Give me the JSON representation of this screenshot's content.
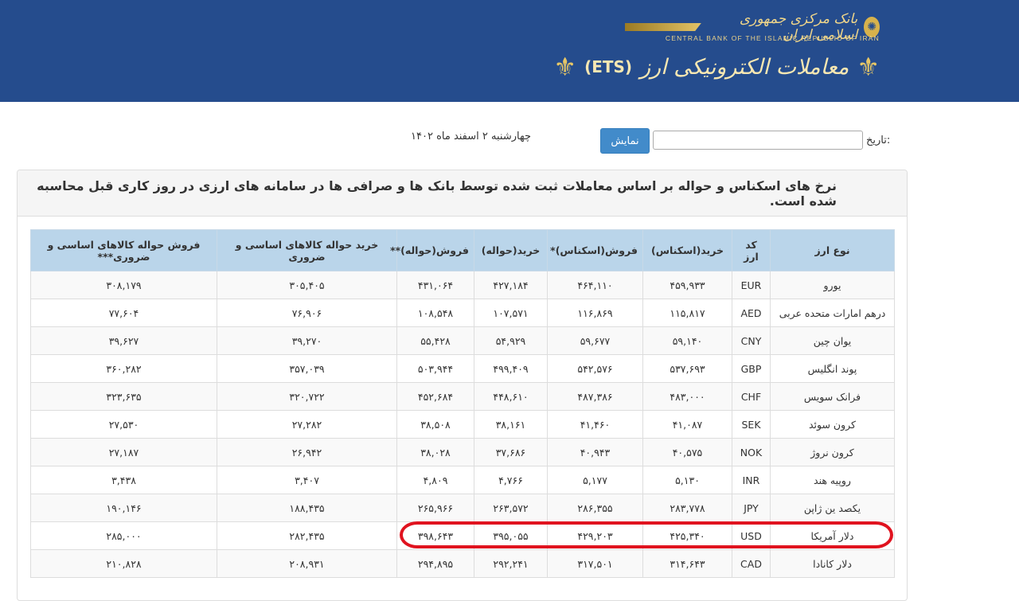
{
  "header": {
    "bank_name_fa": "بانک مرکزی جمهوری اسلامی ایران",
    "bank_name_en": "CENTRAL BANK OF THE ISLAMIC REPUBLIC OF IRAN",
    "system_name_fa": "معاملات الکترونیکی ارز",
    "system_name_en": "(ETS)"
  },
  "filter": {
    "date_label": "تاریخ:",
    "date_value": "",
    "show_button": "نمایش",
    "current_date": "چهارشنبه ۲ اسفند ماه ۱۴۰۲"
  },
  "panel": {
    "title": "نرخ های اسکناس و حواله بر اساس معاملات ثبت شده توسط بانک ها و صرافی ها در سامانه های ارزی در روز کاری قبل محاسبه شده است."
  },
  "table": {
    "columns": [
      "نوع ارز",
      "کد ارز",
      "خرید(اسکناس)",
      "فروش(اسکناس)*",
      "خرید(حواله)",
      "فروش(حواله)**",
      "خرید حواله کالاهای اساسی و ضروری",
      "فروش حواله کالاهای اساسی و ضروری***"
    ],
    "rows": [
      [
        "یورو",
        "EUR",
        "۴۵۹,۹۳۳",
        "۴۶۴,۱۱۰",
        "۴۲۷,۱۸۴",
        "۴۳۱,۰۶۴",
        "۳۰۵,۴۰۵",
        "۳۰۸,۱۷۹"
      ],
      [
        "درهم امارات متحده عربی",
        "AED",
        "۱۱۵,۸۱۷",
        "۱۱۶,۸۶۹",
        "۱۰۷,۵۷۱",
        "۱۰۸,۵۴۸",
        "۷۶,۹۰۶",
        "۷۷,۶۰۴"
      ],
      [
        "یوان چین",
        "CNY",
        "۵۹,۱۴۰",
        "۵۹,۶۷۷",
        "۵۴,۹۲۹",
        "۵۵,۴۲۸",
        "۳۹,۲۷۰",
        "۳۹,۶۲۷"
      ],
      [
        "پوند انگلیس",
        "GBP",
        "۵۳۷,۶۹۳",
        "۵۴۲,۵۷۶",
        "۴۹۹,۴۰۹",
        "۵۰۳,۹۴۴",
        "۳۵۷,۰۳۹",
        "۳۶۰,۲۸۲"
      ],
      [
        "فرانک سویس",
        "CHF",
        "۴۸۳,۰۰۰",
        "۴۸۷,۳۸۶",
        "۴۴۸,۶۱۰",
        "۴۵۲,۶۸۴",
        "۳۲۰,۷۲۲",
        "۳۲۳,۶۳۵"
      ],
      [
        "کرون سوئد",
        "SEK",
        "۴۱,۰۸۷",
        "۴۱,۴۶۰",
        "۳۸,۱۶۱",
        "۳۸,۵۰۸",
        "۲۷,۲۸۲",
        "۲۷,۵۳۰"
      ],
      [
        "کرون نروژ",
        "NOK",
        "۴۰,۵۷۵",
        "۴۰,۹۴۳",
        "۳۷,۶۸۶",
        "۳۸,۰۲۸",
        "۲۶,۹۴۲",
        "۲۷,۱۸۷"
      ],
      [
        "روپیه هند",
        "INR",
        "۵,۱۳۰",
        "۵,۱۷۷",
        "۴,۷۶۶",
        "۴,۸۰۹",
        "۳,۴۰۷",
        "۳,۴۳۸"
      ],
      [
        "یکصد ین ژاپن",
        "JPY",
        "۲۸۳,۷۷۸",
        "۲۸۶,۳۵۵",
        "۲۶۳,۵۷۲",
        "۲۶۵,۹۶۶",
        "۱۸۸,۴۳۵",
        "۱۹۰,۱۴۶"
      ],
      [
        "دلار آمریکا",
        "USD",
        "۴۲۵,۳۴۰",
        "۴۲۹,۲۰۳",
        "۳۹۵,۰۵۵",
        "۳۹۸,۶۴۳",
        "۲۸۲,۴۳۵",
        "۲۸۵,۰۰۰"
      ],
      [
        "دلار کانادا",
        "CAD",
        "۳۱۴,۶۴۳",
        "۳۱۷,۵۰۱",
        "۲۹۲,۲۴۱",
        "۲۹۴,۸۹۵",
        "۲۰۸,۹۳۱",
        "۲۱۰,۸۲۸"
      ]
    ]
  },
  "colors": {
    "header_bg": "#254c8d",
    "gold": "#e3c467",
    "button_bg": "#428bca",
    "table_header_bg": "#bad5ea",
    "highlight": "#e0131f"
  }
}
